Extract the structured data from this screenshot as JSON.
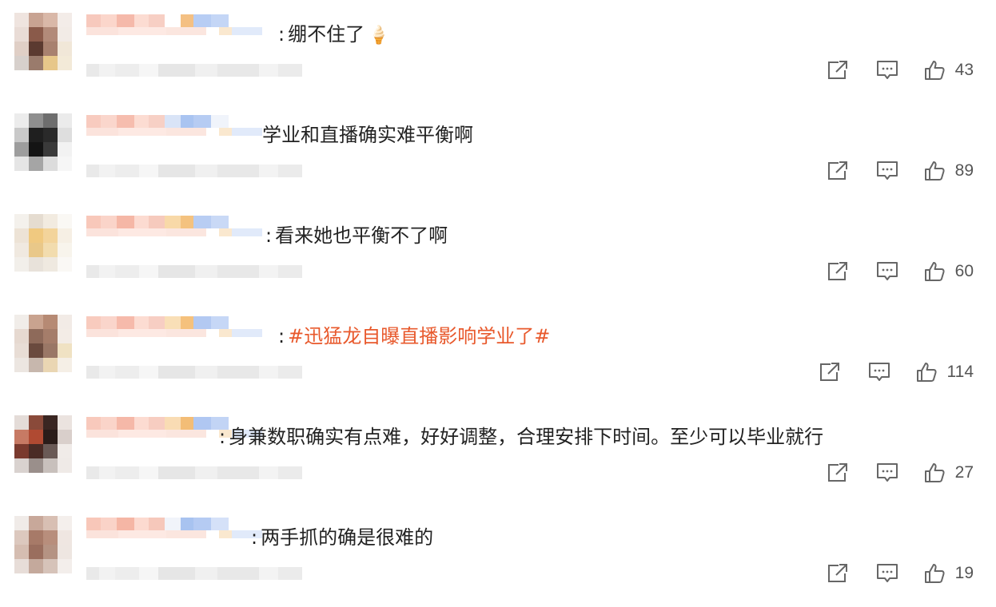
{
  "comments": [
    {
      "text": "绷不住了",
      "emoji": "🍦",
      "likes": "43",
      "avatar": [
        "#efe4df",
        "#c8a392",
        "#d9b8a8",
        "#f3ece8",
        "#e9dcd6",
        "#8a5a4a",
        "#b28a79",
        "#f2ebe6",
        "#e0cfc6",
        "#5b3a30",
        "#a8816f",
        "#f1e7d8",
        "#d7d0cc",
        "#9a7b6c",
        "#e7c78a",
        "#f3ead8"
      ],
      "uname": [
        "#f7c9bd",
        "#fbd6cb",
        "#f5b9aa",
        "#fcdcd2",
        "#f7cfc4",
        "#ffffff",
        "#f4c083",
        "#b7cdf4",
        "#c4d6f6"
      ]
    },
    {
      "text": "学业和直播确实难平衡啊",
      "emoji": "",
      "likes": "89",
      "avatar": [
        "#ececec",
        "#8f8f8f",
        "#6e6e6e",
        "#ebebeb",
        "#c9c9c9",
        "#1f1f1f",
        "#2a2a2a",
        "#dedede",
        "#9d9d9d",
        "#141414",
        "#3a3a3a",
        "#f2f2f2",
        "#e5e5e5",
        "#a5a5a5",
        "#dcdcdc",
        "#f6f6f6"
      ],
      "uname": [
        "#f8cbbf",
        "#fad6cc",
        "#f6bdae",
        "#fcdcd2",
        "#f7d0c5",
        "#d9e4f7",
        "#a9c4f1",
        "#b6ccf3",
        "#f0f4fb"
      ]
    },
    {
      "text": "看来她也平衡不了啊",
      "emoji": "",
      "likes": "60",
      "avatar": [
        "#f4f1ec",
        "#e5dcd0",
        "#f2ebe0",
        "#faf8f4",
        "#ede3d6",
        "#f0c980",
        "#f3d49b",
        "#f6efe4",
        "#f0e9e0",
        "#e9c889",
        "#f2dcae",
        "#f8f4ec",
        "#f2efea",
        "#e8e2da",
        "#efe9e0",
        "#faf8f5"
      ],
      "uname": [
        "#f8c8ba",
        "#fad4c9",
        "#f5b7a6",
        "#fcdbd1",
        "#f6cabd",
        "#f8d9a8",
        "#f4c27f",
        "#b8cdf3",
        "#c9d9f6"
      ]
    },
    {
      "text_prefix": "",
      "topic": "#迅猛龙自曝直播影响学业了#",
      "likes": "114",
      "avatar": [
        "#f1ede9",
        "#c9a38f",
        "#b68a74",
        "#f2ebe6",
        "#e6d9d0",
        "#8e6a5a",
        "#a57d6a",
        "#f3ece6",
        "#e8ddd5",
        "#6a4a3e",
        "#9a7766",
        "#f0e2c3",
        "#ece6e1",
        "#c7b7ad",
        "#ead6b3",
        "#f5efe6"
      ],
      "uname": [
        "#f8cbbe",
        "#fad5cb",
        "#f6baab",
        "#fcdcd2",
        "#f7cec3",
        "#f9dfb7",
        "#f5c17c",
        "#b3c9f2",
        "#c6d7f6"
      ]
    },
    {
      "text": "身兼数职确实有点难，好好调整，合理安排下时间。至少可以毕业就行",
      "emoji": "",
      "likes": "27",
      "avatar": [
        "#e4dcd8",
        "#8a4a3a",
        "#3a2622",
        "#ebe3df",
        "#c77a64",
        "#b04a32",
        "#2a1c19",
        "#d9cfcb",
        "#7a3a2e",
        "#4a2b25",
        "#6a5a56",
        "#f0ebe8",
        "#d9d2cf",
        "#9a8f8b",
        "#c8c0bc",
        "#efeae7"
      ],
      "uname": [
        "#f8c9bc",
        "#fad4c9",
        "#f5b8a8",
        "#fcdbd1",
        "#f7cdc1",
        "#f9dcb4",
        "#f3bd76",
        "#b0c7f2",
        "#c2d4f5"
      ]
    },
    {
      "text": "两手抓的确是很难的",
      "emoji": "",
      "likes": "19",
      "avatar": [
        "#f0ebe8",
        "#c8a89a",
        "#d8bfb3",
        "#f4efec",
        "#dcc8be",
        "#a77a68",
        "#b88e7c",
        "#efe6e1",
        "#d5bdb1",
        "#9a6e5e",
        "#b59383",
        "#eee6e1",
        "#e7ddd8",
        "#c4a99c",
        "#d6c3b9",
        "#f3eeeb"
      ],
      "uname": [
        "#f8c7b9",
        "#fad3c8",
        "#f5b6a5",
        "#fcdad0",
        "#f6c8bb",
        "#f1f4fa",
        "#a8c3f0",
        "#b5cbf3",
        "#d5e1f8"
      ]
    }
  ],
  "icons": {
    "share": "share-icon",
    "comment": "comment-icon",
    "like": "thumbs-up-icon"
  },
  "colors": {
    "topic": "#e8592c",
    "icon": "#666666",
    "text": "#222222"
  }
}
